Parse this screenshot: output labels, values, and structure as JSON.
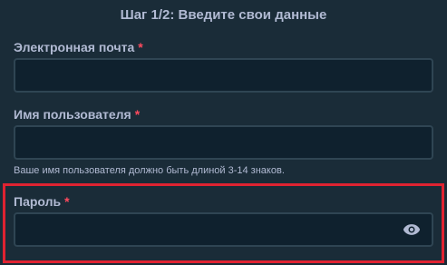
{
  "form": {
    "step_title": "Шаг 1/2: Введите свои данные",
    "required_mark": "*",
    "email": {
      "label": "Электронная почта",
      "value": ""
    },
    "username": {
      "label": "Имя пользователя",
      "value": "",
      "hint": "Ваше имя пользователя должно быть длиной 3-14 знаков."
    },
    "password": {
      "label": "Пароль",
      "value": "",
      "toggle_icon": "eye-icon"
    }
  },
  "colors": {
    "background": "#1a2c38",
    "input_background": "#0f212e",
    "input_border": "#2f4553",
    "label": "#b1bad3",
    "required": "#ff4a5e",
    "highlight": "#e02331"
  }
}
